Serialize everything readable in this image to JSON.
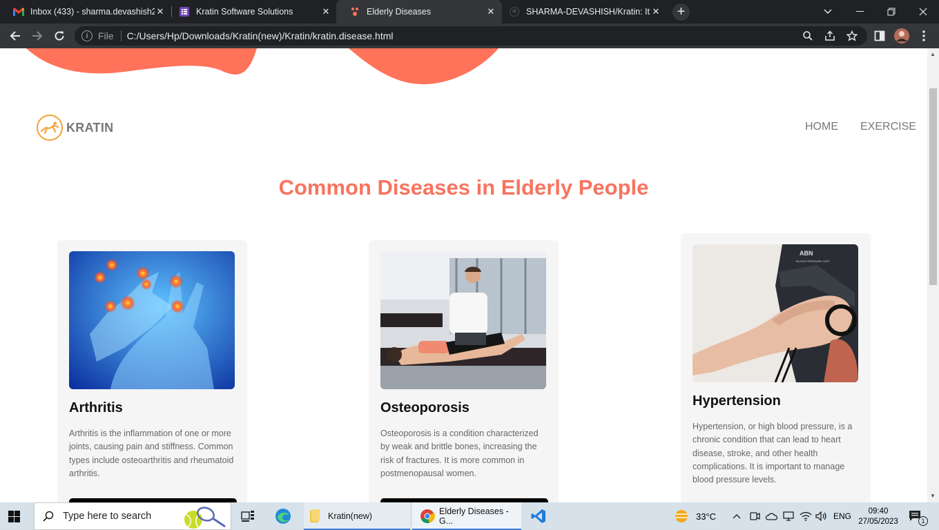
{
  "browser": {
    "tabs": [
      {
        "title": "Inbox (433) - sharma.devashish2",
        "favicon": "gmail-icon"
      },
      {
        "title": "Kratin Software Solutions",
        "favicon": "forms-icon"
      },
      {
        "title": "Elderly Diseases",
        "favicon": "page-icon",
        "active": true
      },
      {
        "title": "SHARMA-DEVASHISH/Kratin: It is",
        "favicon": "github-icon"
      }
    ],
    "address": {
      "scheme_label": "File",
      "url": "C:/Users/Hp/Downloads/Kratin(new)/Kratin/kratin.disease.html"
    }
  },
  "page": {
    "brand": "KRATIN",
    "nav": {
      "home": "HOME",
      "exercise": "EXERCISE"
    },
    "heading": "Common Diseases in Elderly People",
    "accent_color": "#f8745f",
    "cards": [
      {
        "title": "Arthritis",
        "text": "Arthritis is the inflammation of one or more joints, causing pain and stiffness. Common types include osteoarthritis and rheumatoid arthritis."
      },
      {
        "title": "Osteoporosis",
        "text": "Osteoporosis is a condition characterized by weak and brittle bones, increasing the risk of fractures. It is more common in postmenopausal women."
      },
      {
        "title": "Hypertension",
        "text": "Hypertension, or high blood pressure, is a chronic condition that can lead to heart disease, stroke, and other health complications. It is important to manage blood pressure levels."
      }
    ]
  },
  "taskbar": {
    "search_placeholder": "Type here to search",
    "apps": [
      {
        "label": "Kratin(new)",
        "icon": "folder-icon"
      },
      {
        "label": "Elderly Diseases - G...",
        "icon": "chrome-icon"
      }
    ],
    "weather": "33°C",
    "language": "ENG",
    "time": "09:40",
    "date": "27/05/2023",
    "notifications": "1"
  }
}
